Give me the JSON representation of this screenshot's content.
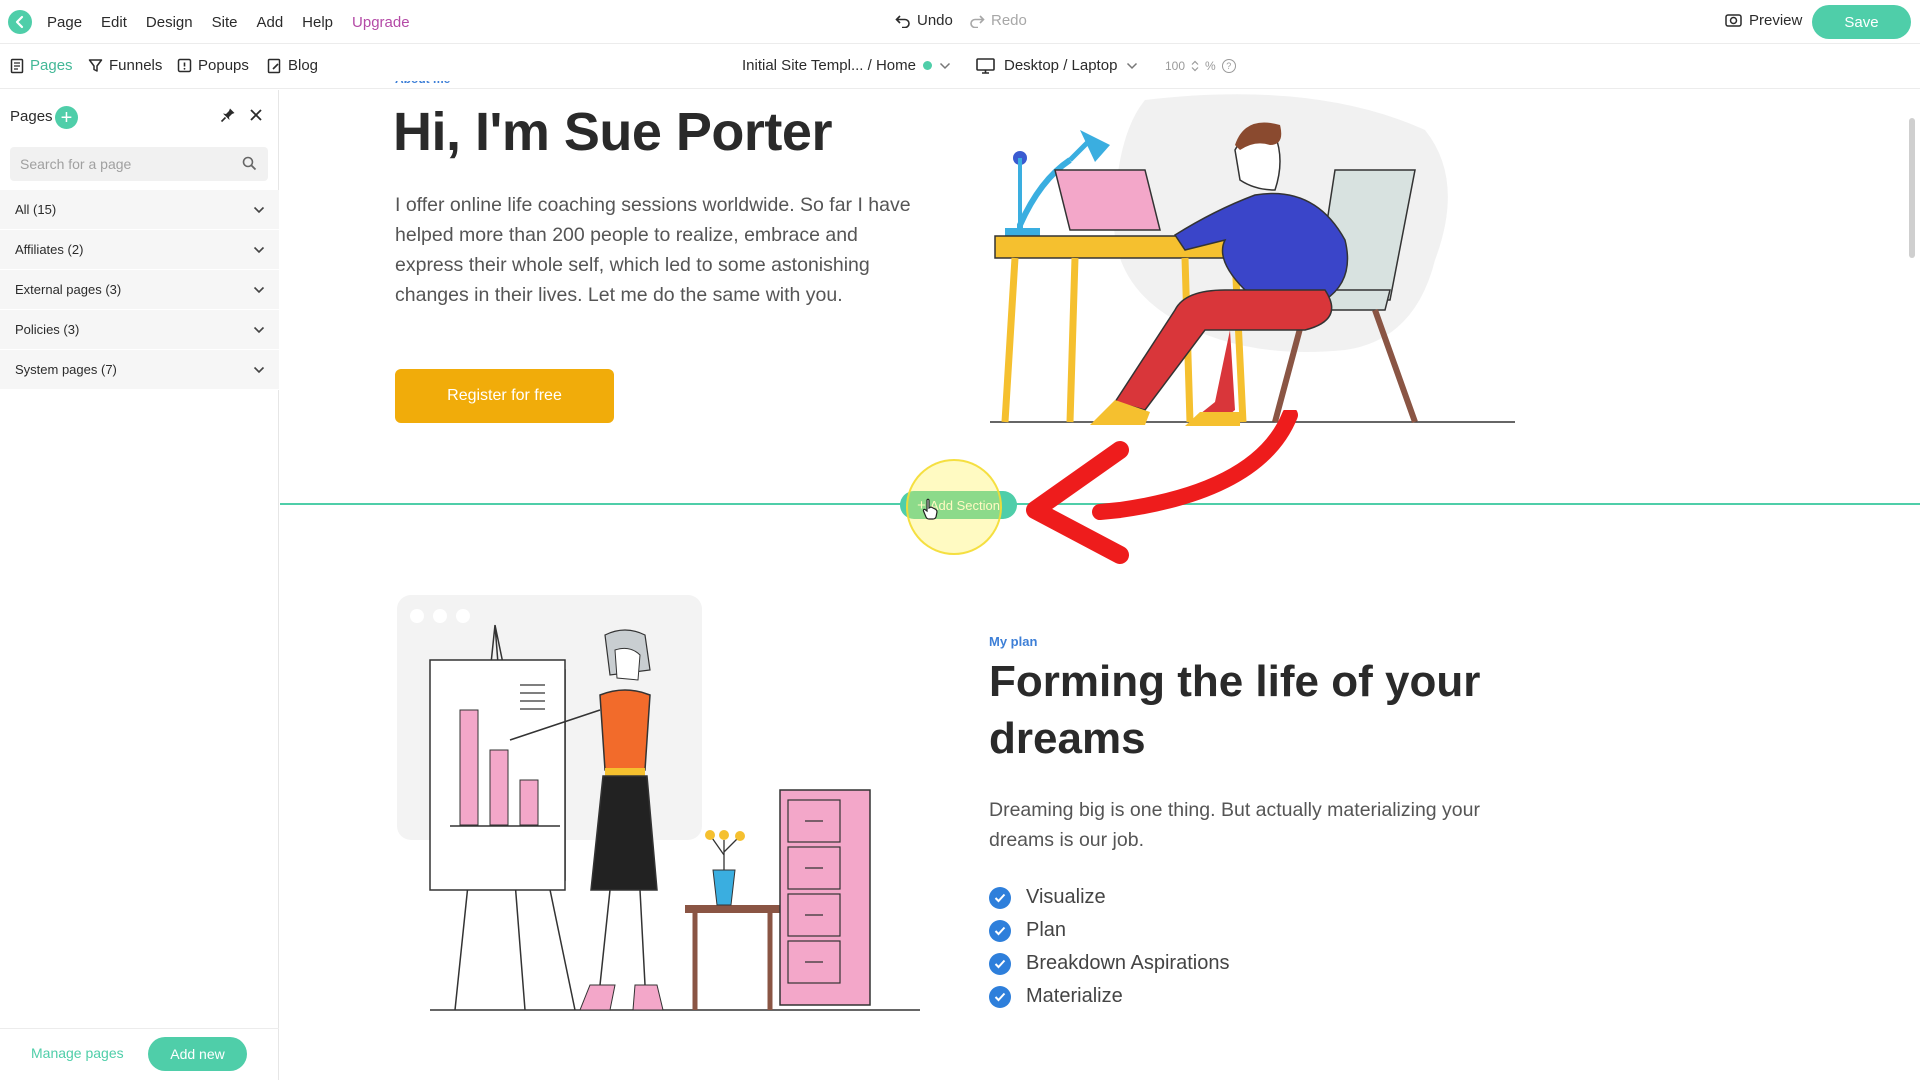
{
  "menubar": {
    "items": [
      "Page",
      "Edit",
      "Design",
      "Site",
      "Add",
      "Help"
    ],
    "upgrade": "Upgrade",
    "undo": "Undo",
    "redo": "Redo",
    "preview": "Preview",
    "save": "Save"
  },
  "toolbar": {
    "pages": "Pages",
    "funnels": "Funnels",
    "popups": "Popups",
    "blog": "Blog",
    "site_path": "Initial Site Templ... / Home",
    "device": "Desktop / Laptop",
    "zoom_value": "100",
    "zoom_unit": "%",
    "help": "?"
  },
  "sidebar": {
    "title": "Pages",
    "search_placeholder": "Search for a page",
    "groups": [
      {
        "label": "All (15)"
      },
      {
        "label": "Affiliates (2)"
      },
      {
        "label": "External pages (3)"
      },
      {
        "label": "Policies (3)"
      },
      {
        "label": "System pages (7)"
      }
    ],
    "manage": "Manage pages",
    "add_new": "Add new"
  },
  "canvas": {
    "hero": {
      "eyebrow": "About me",
      "title": "Hi, I'm Sue Porter",
      "text": "I offer online life coaching sessions worldwide. So far I have helped more than 200 people to realize, embrace and express their whole self, which led to some astonishing changes in their lives. Let me do the same with you.",
      "cta": "Register for free"
    },
    "add_section": "Add Section",
    "plan": {
      "eyebrow": "My plan",
      "title": "Forming the life of your dreams",
      "text": "Dreaming big is one thing. But actually materializing your dreams is our job.",
      "items": [
        "Visualize",
        "Plan",
        "Breakdown Aspirations",
        "Materialize"
      ]
    }
  },
  "colors": {
    "accent": "#4fcea9",
    "upgrade": "#b44aa6",
    "cta": "#f1ac0a",
    "link_blue": "#3d7fd7",
    "arrow": "#ee1c1c"
  }
}
